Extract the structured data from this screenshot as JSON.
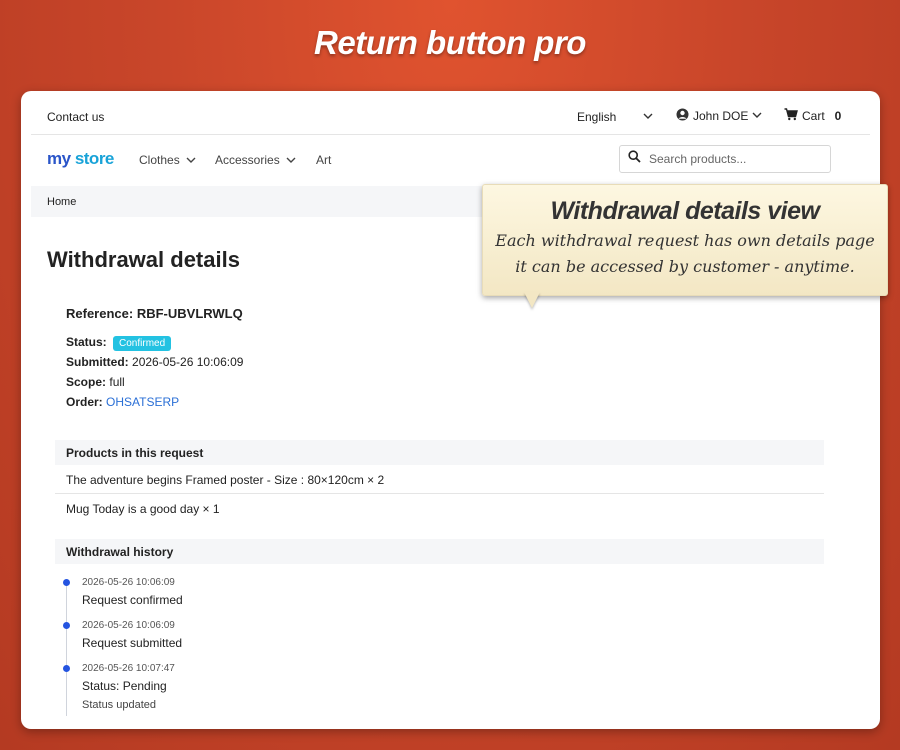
{
  "banner": {
    "title": "Return button pro"
  },
  "topbar": {
    "contact": "Contact us",
    "language": "English",
    "user": "John DOE",
    "cart_label": "Cart",
    "cart_count": "0"
  },
  "nav": {
    "logo": {
      "part1": "my",
      "part2": "store"
    },
    "items": [
      "Clothes",
      "Accessories",
      "Art"
    ],
    "search_placeholder": "Search products..."
  },
  "breadcrumb": {
    "home": "Home"
  },
  "page": {
    "title": "Withdrawal details",
    "reference_label": "Reference:",
    "reference": "RBF-UBVLRWLQ",
    "status_label": "Status:",
    "status": "Confirmed",
    "submitted_label": "Submitted:",
    "submitted": "2026-05-26 10:06:09",
    "scope_label": "Scope:",
    "scope": "full",
    "order_label": "Order:",
    "order": "OHSATSERP"
  },
  "products": {
    "heading": "Products in this request",
    "items": [
      "The adventure begins Framed poster - Size : 80×120cm × 2",
      "Mug Today is a good day × 1"
    ]
  },
  "history": {
    "heading": "Withdrawal history",
    "events": [
      {
        "date": "2026-05-26 10:06:09",
        "text": "Request confirmed"
      },
      {
        "date": "2026-05-26 10:06:09",
        "text": "Request submitted"
      },
      {
        "date": "2026-05-26 10:07:47",
        "text": "Status: Pending",
        "sub": "Status updated"
      }
    ]
  },
  "callout": {
    "title": "Withdrawal details view",
    "line1": "Each withdrawal request has own details page",
    "line2": "it can be accessed by customer - anytime."
  },
  "colors": {
    "background": "#c9462a",
    "badge": "#23c2e2",
    "link": "#2a6fd6",
    "timeline_dot": "#2454e0"
  }
}
